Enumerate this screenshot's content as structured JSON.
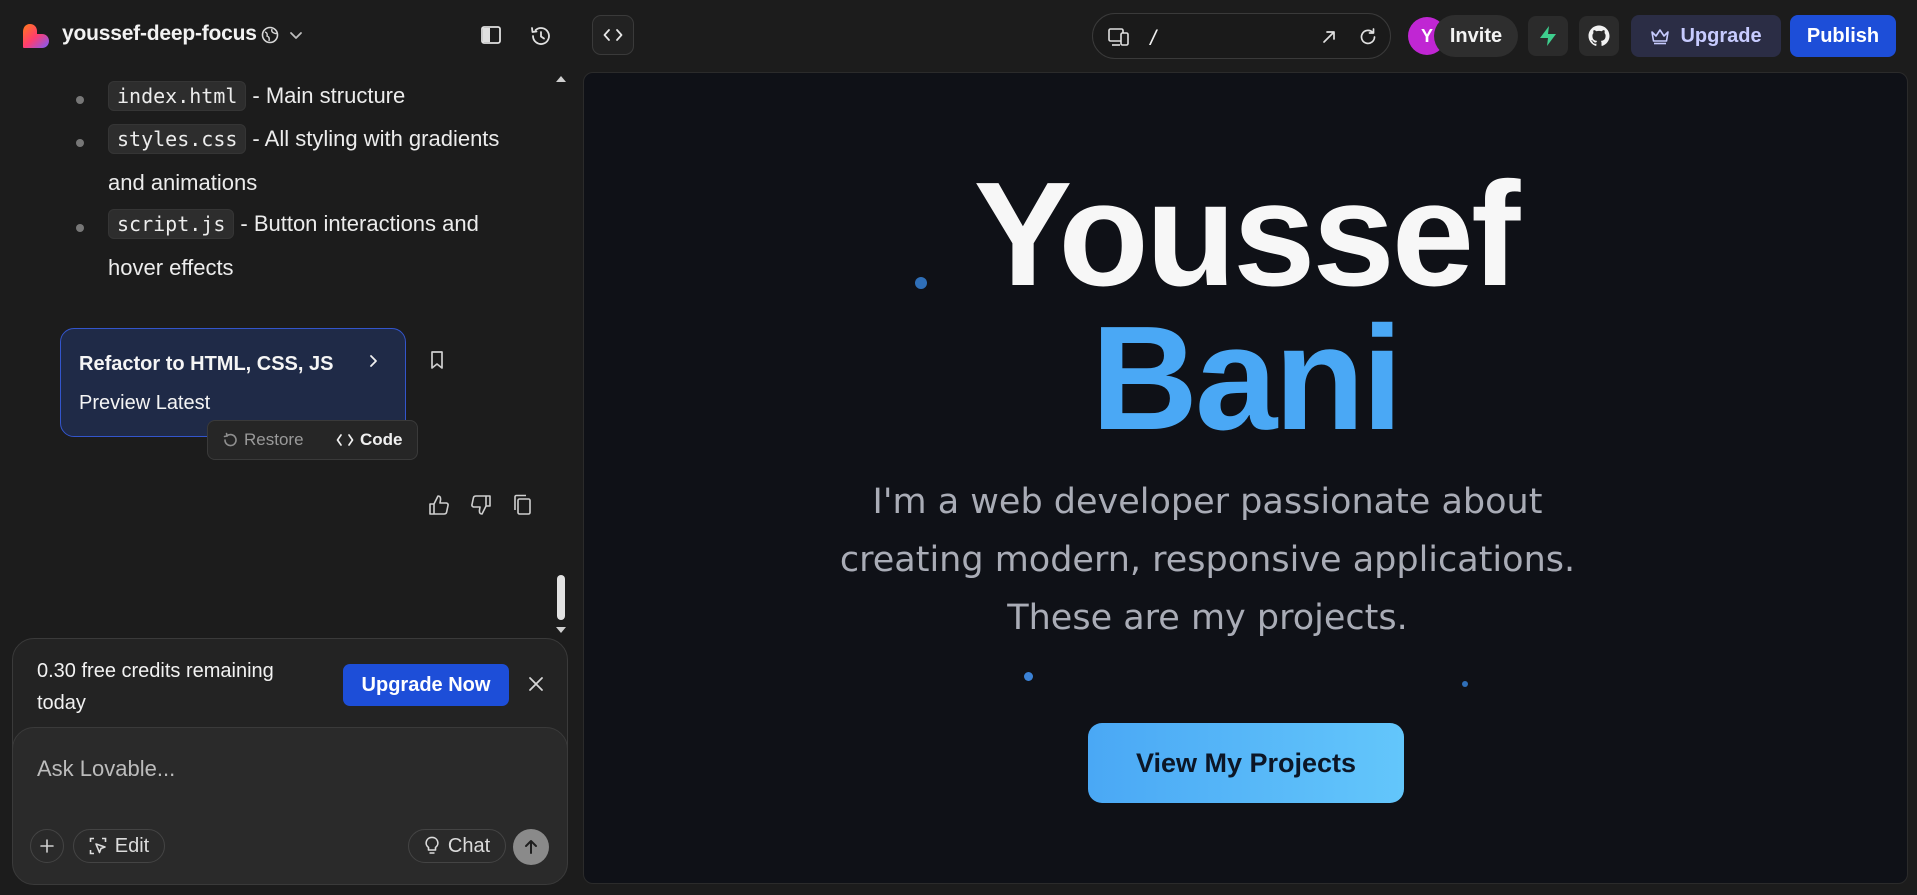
{
  "header": {
    "project_name": "youssef-deep-focus",
    "url_path": "/",
    "avatar_initial": "Y",
    "invite_label": "Invite",
    "upgrade_label": "Upgrade",
    "publish_label": "Publish",
    "accent_color": "#1d4ed8"
  },
  "chat": {
    "files": [
      {
        "name": "index.html",
        "description": "- Main structure"
      },
      {
        "name": "styles.css",
        "description": "- All styling with gradients",
        "continuation": "and animations"
      },
      {
        "name": "script.js",
        "description": "- Button interactions and",
        "continuation": "hover effects"
      }
    ],
    "version_card": {
      "title": "Refactor to HTML, CSS, JS",
      "subtitle": "Preview Latest"
    },
    "restore_label": "Restore",
    "code_label": "Code",
    "credits_text": "0.30 free credits remaining today",
    "upgrade_now_label": "Upgrade Now",
    "input_placeholder": "Ask Lovable...",
    "edit_label": "Edit",
    "chat_label": "Chat"
  },
  "preview": {
    "first_name": "Youssef",
    "last_name": "Bani",
    "tagline": "I'm a web developer passionate about creating modern, responsive applications. These are my projects.",
    "cta_label": "View My Projects",
    "name_color": "#4aa8f5"
  },
  "icons": [
    "lovable-logo-icon",
    "globe-icon",
    "chevron-down-icon",
    "sidebar-toggle-icon",
    "history-icon",
    "code-icon",
    "device-icon",
    "open-external-icon",
    "reload-icon",
    "supabase-icon",
    "github-icon",
    "crown-icon",
    "bookmark-icon",
    "thumbs-up-icon",
    "thumbs-down-icon",
    "copy-icon",
    "close-icon",
    "plus-icon",
    "edit-select-icon",
    "lightbulb-icon",
    "arrow-up-icon"
  ]
}
